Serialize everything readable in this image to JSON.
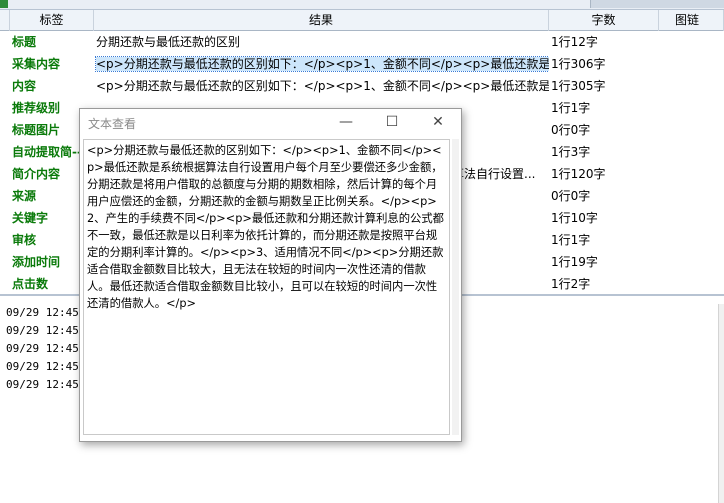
{
  "grid": {
    "columns": [
      "标签",
      "结果",
      "字数",
      "图链"
    ],
    "rows": [
      {
        "label": "标题",
        "result": "分期还款与最低还款的区别",
        "count": "1行12字"
      },
      {
        "label": "采集内容",
        "result": "<p>分期还款与最低还款的区别如下：</p><p>1、金额不同</p><p>最低还款是系 . . .",
        "count": "1行306字"
      },
      {
        "label": "内容",
        "result": "<p>分期还款与最低还款的区别如下：</p><p>1、金额不同</p><p>最低还款是系统...",
        "count": "1行305字"
      },
      {
        "label": "推荐级别",
        "result": "",
        "count": "1行1字"
      },
      {
        "label": "标题图片",
        "result": "",
        "count": "0行0字"
      },
      {
        "label": "自动提取简--",
        "result": "",
        "count": "1行3字"
      },
      {
        "label": "简介内容",
        "result": "算法自行设置...",
        "count": "1行120字"
      },
      {
        "label": "来源",
        "result": "",
        "count": "0行0字"
      },
      {
        "label": "关键字",
        "result": "",
        "count": "1行10字"
      },
      {
        "label": "审核",
        "result": "",
        "count": "1行1字"
      },
      {
        "label": "添加时间",
        "result": "",
        "count": "1行19字"
      },
      {
        "label": "点击数",
        "result": "",
        "count": "1行2字"
      }
    ]
  },
  "log": {
    "lines": [
      "09/29 12:45:",
      "09/29 12:45:",
      "09/29 12:45:",
      "09/29 12:45:",
      "09/29 12:45:"
    ]
  },
  "dialog": {
    "title": "文本查看",
    "minimize": "—",
    "maximize": "☐",
    "close": "✕",
    "text": "<p>分期还款与最低还款的区别如下：</p><p>1、金额不同</p><p>最低还款是系统根据算法自行设置用户每个月至少要偿还多少金额，分期还款是将用户借取的总额度与分期的期数相除，然后计算的每个月用户应偿还的金额，分期还款的金额与期数呈正比例关系。</p><p>2、产生的手续费不同</p><p>最低还款和分期还款计算利息的公式都不一致，最低还款是以日利率为依托计算的，而分期还款是按照平台规定的分期利率计算的。</p><p>3、适用情况不同</p><p>分期还款适合借取金额数目比较大，且无法在较短的时间内一次性还清的借款人。最低还款适合借取金额数目比较小，且可以在较短的时间内一次性还清的借款人。</p>"
  },
  "colors": {
    "label_green": "#0a7a0a",
    "selection": "#cde6fb",
    "header_bg": "#eef3f9"
  }
}
